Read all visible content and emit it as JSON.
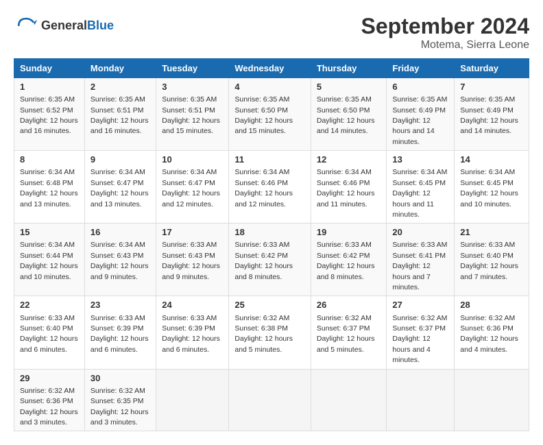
{
  "header": {
    "logo_general": "General",
    "logo_blue": "Blue",
    "month_title": "September 2024",
    "location": "Motema, Sierra Leone"
  },
  "columns": [
    "Sunday",
    "Monday",
    "Tuesday",
    "Wednesday",
    "Thursday",
    "Friday",
    "Saturday"
  ],
  "weeks": [
    [
      {
        "day": "1",
        "sunrise": "Sunrise: 6:35 AM",
        "sunset": "Sunset: 6:52 PM",
        "daylight": "Daylight: 12 hours and 16 minutes."
      },
      {
        "day": "2",
        "sunrise": "Sunrise: 6:35 AM",
        "sunset": "Sunset: 6:51 PM",
        "daylight": "Daylight: 12 hours and 16 minutes."
      },
      {
        "day": "3",
        "sunrise": "Sunrise: 6:35 AM",
        "sunset": "Sunset: 6:51 PM",
        "daylight": "Daylight: 12 hours and 15 minutes."
      },
      {
        "day": "4",
        "sunrise": "Sunrise: 6:35 AM",
        "sunset": "Sunset: 6:50 PM",
        "daylight": "Daylight: 12 hours and 15 minutes."
      },
      {
        "day": "5",
        "sunrise": "Sunrise: 6:35 AM",
        "sunset": "Sunset: 6:50 PM",
        "daylight": "Daylight: 12 hours and 14 minutes."
      },
      {
        "day": "6",
        "sunrise": "Sunrise: 6:35 AM",
        "sunset": "Sunset: 6:49 PM",
        "daylight": "Daylight: 12 hours and 14 minutes."
      },
      {
        "day": "7",
        "sunrise": "Sunrise: 6:35 AM",
        "sunset": "Sunset: 6:49 PM",
        "daylight": "Daylight: 12 hours and 14 minutes."
      }
    ],
    [
      {
        "day": "8",
        "sunrise": "Sunrise: 6:34 AM",
        "sunset": "Sunset: 6:48 PM",
        "daylight": "Daylight: 12 hours and 13 minutes."
      },
      {
        "day": "9",
        "sunrise": "Sunrise: 6:34 AM",
        "sunset": "Sunset: 6:47 PM",
        "daylight": "Daylight: 12 hours and 13 minutes."
      },
      {
        "day": "10",
        "sunrise": "Sunrise: 6:34 AM",
        "sunset": "Sunset: 6:47 PM",
        "daylight": "Daylight: 12 hours and 12 minutes."
      },
      {
        "day": "11",
        "sunrise": "Sunrise: 6:34 AM",
        "sunset": "Sunset: 6:46 PM",
        "daylight": "Daylight: 12 hours and 12 minutes."
      },
      {
        "day": "12",
        "sunrise": "Sunrise: 6:34 AM",
        "sunset": "Sunset: 6:46 PM",
        "daylight": "Daylight: 12 hours and 11 minutes."
      },
      {
        "day": "13",
        "sunrise": "Sunrise: 6:34 AM",
        "sunset": "Sunset: 6:45 PM",
        "daylight": "Daylight: 12 hours and 11 minutes."
      },
      {
        "day": "14",
        "sunrise": "Sunrise: 6:34 AM",
        "sunset": "Sunset: 6:45 PM",
        "daylight": "Daylight: 12 hours and 10 minutes."
      }
    ],
    [
      {
        "day": "15",
        "sunrise": "Sunrise: 6:34 AM",
        "sunset": "Sunset: 6:44 PM",
        "daylight": "Daylight: 12 hours and 10 minutes."
      },
      {
        "day": "16",
        "sunrise": "Sunrise: 6:34 AM",
        "sunset": "Sunset: 6:43 PM",
        "daylight": "Daylight: 12 hours and 9 minutes."
      },
      {
        "day": "17",
        "sunrise": "Sunrise: 6:33 AM",
        "sunset": "Sunset: 6:43 PM",
        "daylight": "Daylight: 12 hours and 9 minutes."
      },
      {
        "day": "18",
        "sunrise": "Sunrise: 6:33 AM",
        "sunset": "Sunset: 6:42 PM",
        "daylight": "Daylight: 12 hours and 8 minutes."
      },
      {
        "day": "19",
        "sunrise": "Sunrise: 6:33 AM",
        "sunset": "Sunset: 6:42 PM",
        "daylight": "Daylight: 12 hours and 8 minutes."
      },
      {
        "day": "20",
        "sunrise": "Sunrise: 6:33 AM",
        "sunset": "Sunset: 6:41 PM",
        "daylight": "Daylight: 12 hours and 7 minutes."
      },
      {
        "day": "21",
        "sunrise": "Sunrise: 6:33 AM",
        "sunset": "Sunset: 6:40 PM",
        "daylight": "Daylight: 12 hours and 7 minutes."
      }
    ],
    [
      {
        "day": "22",
        "sunrise": "Sunrise: 6:33 AM",
        "sunset": "Sunset: 6:40 PM",
        "daylight": "Daylight: 12 hours and 6 minutes."
      },
      {
        "day": "23",
        "sunrise": "Sunrise: 6:33 AM",
        "sunset": "Sunset: 6:39 PM",
        "daylight": "Daylight: 12 hours and 6 minutes."
      },
      {
        "day": "24",
        "sunrise": "Sunrise: 6:33 AM",
        "sunset": "Sunset: 6:39 PM",
        "daylight": "Daylight: 12 hours and 6 minutes."
      },
      {
        "day": "25",
        "sunrise": "Sunrise: 6:32 AM",
        "sunset": "Sunset: 6:38 PM",
        "daylight": "Daylight: 12 hours and 5 minutes."
      },
      {
        "day": "26",
        "sunrise": "Sunrise: 6:32 AM",
        "sunset": "Sunset: 6:37 PM",
        "daylight": "Daylight: 12 hours and 5 minutes."
      },
      {
        "day": "27",
        "sunrise": "Sunrise: 6:32 AM",
        "sunset": "Sunset: 6:37 PM",
        "daylight": "Daylight: 12 hours and 4 minutes."
      },
      {
        "day": "28",
        "sunrise": "Sunrise: 6:32 AM",
        "sunset": "Sunset: 6:36 PM",
        "daylight": "Daylight: 12 hours and 4 minutes."
      }
    ],
    [
      {
        "day": "29",
        "sunrise": "Sunrise: 6:32 AM",
        "sunset": "Sunset: 6:36 PM",
        "daylight": "Daylight: 12 hours and 3 minutes."
      },
      {
        "day": "30",
        "sunrise": "Sunrise: 6:32 AM",
        "sunset": "Sunset: 6:35 PM",
        "daylight": "Daylight: 12 hours and 3 minutes."
      },
      null,
      null,
      null,
      null,
      null
    ]
  ]
}
